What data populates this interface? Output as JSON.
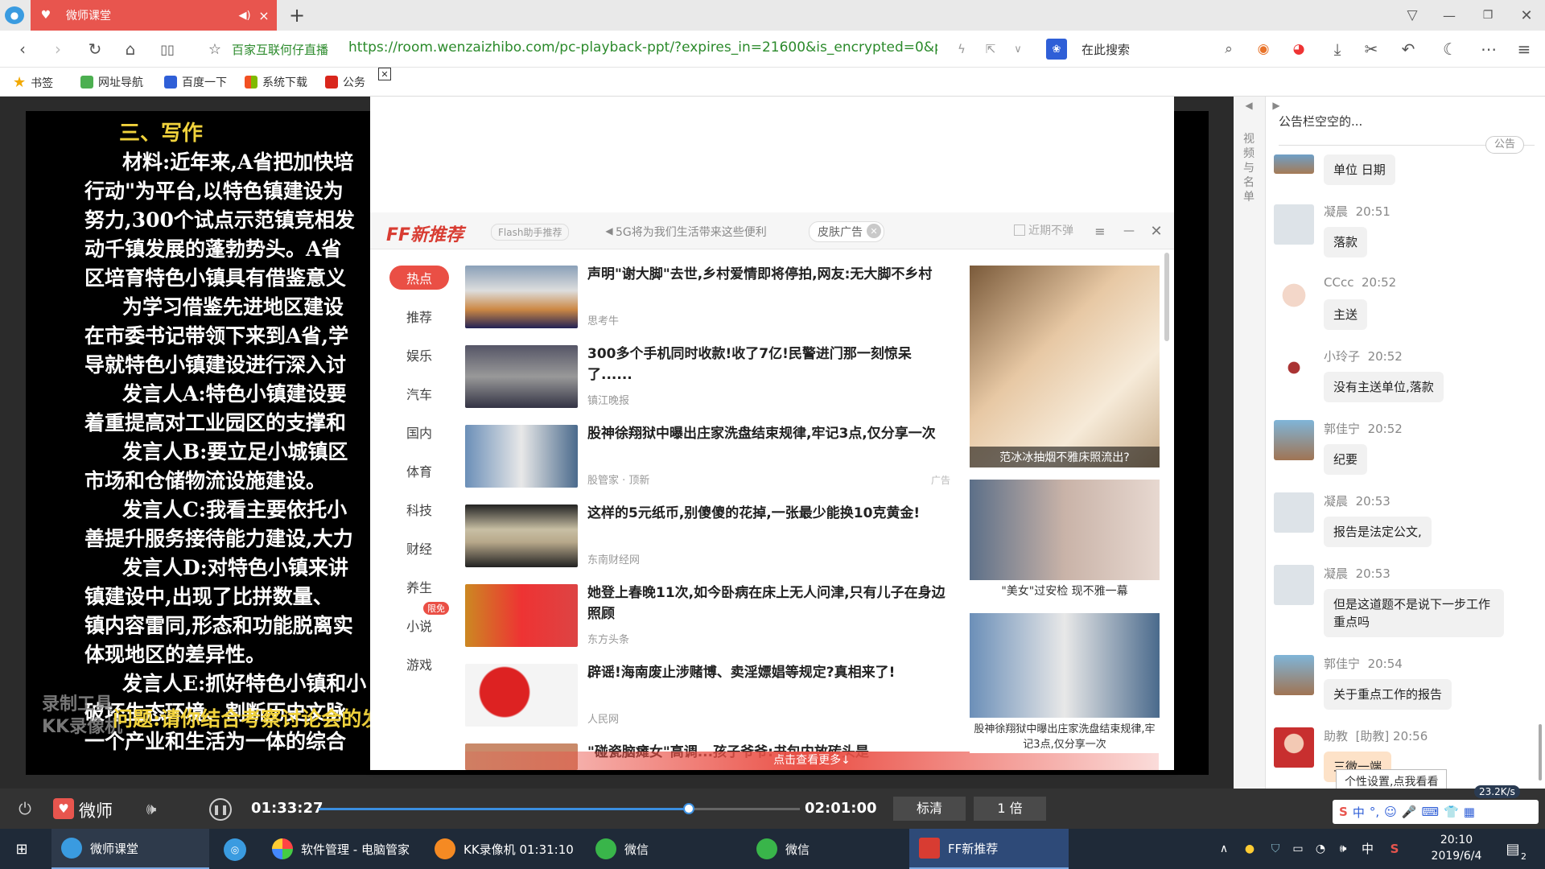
{
  "browser": {
    "tab_title": "微师课堂",
    "new_tab_symbol": "+",
    "url_prefix_label": "百家互联何仔直播",
    "url": "https://room.wenzaizhibo.com/pc-playback-ppt/?expires_in=21600&is_encrypted=0&p",
    "search_placeholder": "在此搜索",
    "bookmarks": [
      "书签",
      "网址导航",
      "百度一下",
      "系统下载",
      "公务"
    ]
  },
  "slide": {
    "heading": "三、写作",
    "lines": [
      "材料:近年来,A省把加快培",
      "行动\"为平台,以特色镇建设为",
      "努力,300个试点示范镇竞相发",
      "动千镇发展的蓬勃势头。A省",
      "区培育特色小镇具有借鉴意义",
      "为学习借鉴先进地区建设",
      "在市委书记带领下来到A省,学",
      "导就特色小镇建设进行深入讨",
      "发言人A:特色小镇建设要",
      "着重提高对工业园区的支撑和",
      "发言人B:要立足小城镇区",
      "市场和仓储物流设施建设。",
      "发言人C:我看主要依托小",
      "善提升服务接待能力建设,大力",
      "发言人D:对特色小镇来讲",
      "镇建设中,出现了比拼数量、",
      "镇内容雷同,形态和功能脱离实",
      "体现地区的差异性。",
      "发言人E:抓好特色小镇和小",
      "破坏生态环境、割断历史文脉",
      "一个产业和生活为一体的综合",
      "问题:请你结合考察讨论会的发"
    ],
    "watermark_line1": "录制工具",
    "watermark_line2": "KK录像机"
  },
  "sidepanel": {
    "tab_label": "视频与名单",
    "notice": "公告栏空空的...",
    "notice_badge": "公告",
    "messages": [
      {
        "name": "",
        "time": "",
        "text": "单位 日期"
      },
      {
        "name": "凝晨",
        "time": "20:51",
        "text": "落款"
      },
      {
        "name": "CCcc",
        "time": "20:52",
        "text": "主送"
      },
      {
        "name": "小玲子",
        "time": "20:52",
        "text": "没有主送单位,落款"
      },
      {
        "name": "郭佳宁",
        "time": "20:52",
        "text": "纪要"
      },
      {
        "name": "凝晨",
        "time": "20:53",
        "text": "报告是法定公文,"
      },
      {
        "name": "凝晨",
        "time": "20:53",
        "text": "但是这道题不是说下一步工作重点吗"
      },
      {
        "name": "郭佳宁",
        "time": "20:54",
        "text": "关于重点工作的报告"
      },
      {
        "name": "助教",
        "time": "[助教] 20:56",
        "text": "三微一端"
      }
    ],
    "ime_tooltip": "个性设置,点我看看",
    "net_speed": "23.2K/s"
  },
  "popup": {
    "logo": "FF新推荐",
    "subtitle": "Flash助手推荐",
    "marquee": "5G将为我们生活带来这些便利",
    "skin_button": "皮肤广告",
    "no_remind": "近期不弹",
    "categories": [
      "热点",
      "推荐",
      "娱乐",
      "汽车",
      "国内",
      "体育",
      "科技",
      "财经",
      "养生",
      "小说",
      "游戏"
    ],
    "limited_badge": "限免",
    "news": [
      {
        "title": "声明\"谢大脚\"去世,乡村爱情即将停拍,网友:无大脚不乡村",
        "source": "思考牛"
      },
      {
        "title": "300多个手机同时收款!收了7亿!民警进门那一刻惊呆了......",
        "source": "镇江晚报"
      },
      {
        "title": "股神徐翔狱中曝出庄家洗盘结束规律,牢记3点,仅分享一次",
        "source": "股管家 · 顶新",
        "ad": "广告"
      },
      {
        "title": "这样的5元纸币,别傻傻的花掉,一张最少能换10克黄金!",
        "source": "东南财经网"
      },
      {
        "title": "她登上春晚11次,如今卧病在床上无人问津,只有儿子在身边照顾",
        "source": "东方头条"
      },
      {
        "title": "辟谣!海南废止涉赌博、卖淫嫖娼等规定?真相来了!",
        "source": "人民网"
      },
      {
        "title": "\"碰瓷脑瘫女\"高调...孩子爷爷:书包内放砖头是",
        "source": ""
      }
    ],
    "side_ads": [
      "范冰冰抽烟不雅床照流出?",
      "\"美女\"过安检 现不雅一幕",
      "股神徐翔狱中曝出庄家洗盘结束规律,牢记3点,仅分享一次"
    ],
    "more_button": "点击查看更多↓"
  },
  "player": {
    "brand": "微师",
    "current_time": "01:33:27",
    "total_time": "02:01:00",
    "progress": 0.77,
    "quality": "标清",
    "speed": "1 倍"
  },
  "taskbar": {
    "items": [
      "微师课堂",
      "软件管理 - 电脑管家",
      "KK录像机 01:31:10",
      "微信",
      "微信",
      "FF新推荐"
    ],
    "ime": "中",
    "time": "20:10",
    "date": "2019/6/4",
    "notification_count": "2"
  },
  "colors": {
    "accent": "#e8554e",
    "brand_red": "#d83c32",
    "link_green": "#2b8a2b",
    "slide_yellow": "#f0d23c"
  }
}
